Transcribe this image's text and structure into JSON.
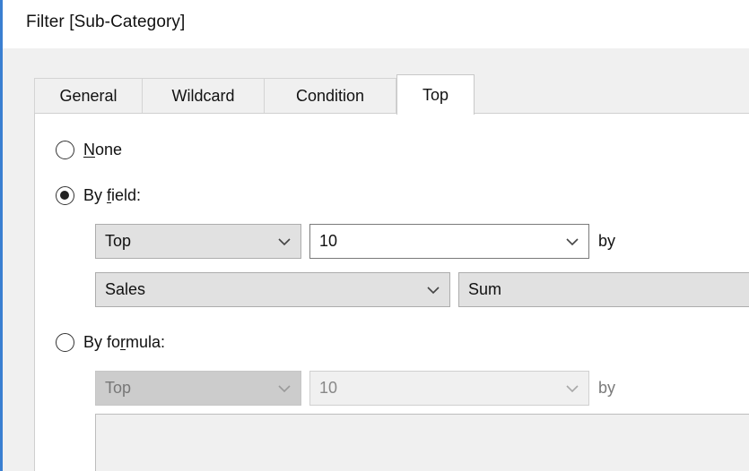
{
  "window": {
    "title": "Filter [Sub-Category]"
  },
  "tabs": [
    {
      "label": "General"
    },
    {
      "label": "Wildcard"
    },
    {
      "label": "Condition"
    },
    {
      "label": "Top",
      "active": true
    }
  ],
  "options": {
    "none": {
      "label_first": "N",
      "label_rest": "one",
      "selected": false
    },
    "by_field": {
      "label_pre": "By ",
      "label_u": "f",
      "label_post": "ield:",
      "selected": true
    },
    "by_formula": {
      "label_pre": "By fo",
      "label_u": "r",
      "label_post": "mula:",
      "selected": false
    }
  },
  "by_field": {
    "direction": "Top",
    "count": "10",
    "by_label": "by",
    "field": "Sales",
    "aggregation": "Sum"
  },
  "by_formula": {
    "direction": "Top",
    "count": "10",
    "by_label": "by",
    "formula": ""
  },
  "colors": {
    "accent_border": "#3a7fd1",
    "dialog_bg": "#f0f0f0",
    "combo_bg": "#e1e1e1"
  }
}
